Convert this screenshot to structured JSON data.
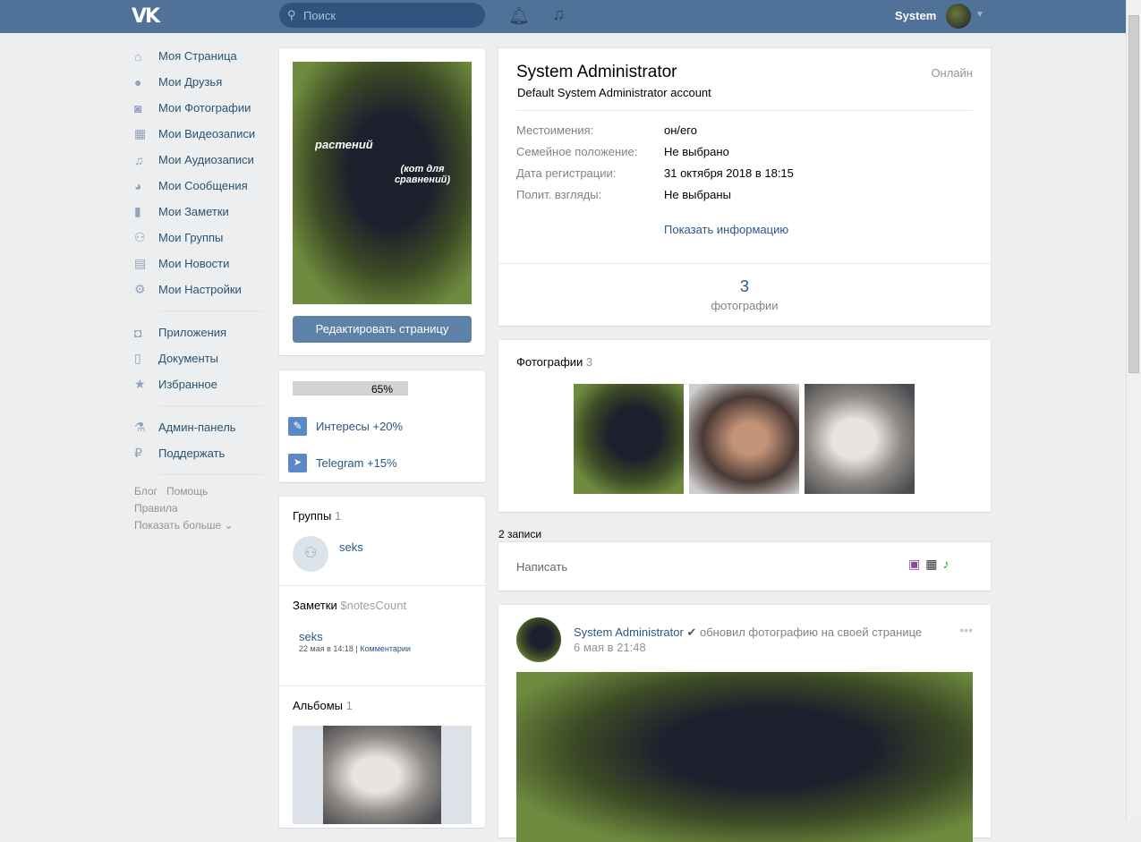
{
  "header": {
    "logo": "VK",
    "search_placeholder": "Поиск",
    "user_name": "System"
  },
  "sidebar": {
    "items": [
      {
        "icon": "home-icon",
        "glyph": "⌂",
        "label": "Моя Страница"
      },
      {
        "icon": "user-icon",
        "glyph": "●",
        "label": "Мои Друзья"
      },
      {
        "icon": "camera-icon",
        "glyph": "◙",
        "label": "Мои Фотографии"
      },
      {
        "icon": "film-icon",
        "glyph": "▦",
        "label": "Мои Видеозаписи"
      },
      {
        "icon": "music-icon",
        "glyph": "♫",
        "label": "Мои Аудиозаписи"
      },
      {
        "icon": "chat-icon",
        "glyph": "◕",
        "label": "Мои Сообщения"
      },
      {
        "icon": "notes-icon",
        "glyph": "▮",
        "label": "Мои Заметки"
      },
      {
        "icon": "groups-icon",
        "glyph": "⚇",
        "label": "Мои Группы"
      },
      {
        "icon": "news-icon",
        "glyph": "▤",
        "label": "Мои Новости"
      },
      {
        "icon": "gear-icon",
        "glyph": "⚙",
        "label": "Мои Настройки"
      }
    ],
    "items2": [
      {
        "icon": "gamepad-icon",
        "glyph": "◘",
        "label": "Приложения"
      },
      {
        "icon": "document-icon",
        "glyph": "▯",
        "label": "Документы"
      },
      {
        "icon": "star-icon",
        "glyph": "★",
        "label": "Избранное"
      }
    ],
    "items3": [
      {
        "icon": "flask-icon",
        "glyph": "⚗",
        "label": "Админ-панель"
      },
      {
        "icon": "ruble-icon",
        "glyph": "₽",
        "label": "Поддержать"
      }
    ],
    "footer": {
      "blog": "Блог",
      "help": "Помощь",
      "rules": "Правила",
      "more": "Показать больше"
    }
  },
  "profile": {
    "edit_button": "Редактировать страницу",
    "photo_text1": "растений",
    "photo_text2": "(кот для сравнений)"
  },
  "completion": {
    "percent": 65,
    "percent_label": "65%",
    "items": [
      {
        "label": "Интересы +20%"
      },
      {
        "label": "Telegram +15%"
      }
    ]
  },
  "groups": {
    "title": "Группы",
    "count": "1",
    "items": [
      {
        "name": "seks"
      }
    ]
  },
  "notes": {
    "title": "Заметки",
    "count": "$notesCount",
    "items": [
      {
        "title": "seks",
        "date": "22 мая в 14:18",
        "sep": "|",
        "comments": "Комментарии"
      }
    ]
  },
  "albums": {
    "title": "Альбомы",
    "count": "1"
  },
  "info": {
    "name": "System Administrator",
    "status": "Default System Administrator account",
    "online": "Онлайн",
    "rows": [
      {
        "label": "Местоимения:",
        "value": "он/его"
      },
      {
        "label": "Семейное положение:",
        "value": "Не выбрано"
      },
      {
        "label": "Дата регистрации:",
        "value": "31 октября 2018 в 18:15"
      },
      {
        "label": "Полит. взгляды:",
        "value": "Не выбраны"
      }
    ],
    "show_more": "Показать информацию",
    "counter_value": "3",
    "counter_label": "фотографии"
  },
  "photos": {
    "title": "Фотографии",
    "count": "3"
  },
  "wall": {
    "count_label": "2 записи",
    "write_placeholder": "Написать",
    "post": {
      "author": "System Administrator",
      "action": "обновил фотографию на своей странице",
      "date": "6 мая в 21:48"
    }
  }
}
